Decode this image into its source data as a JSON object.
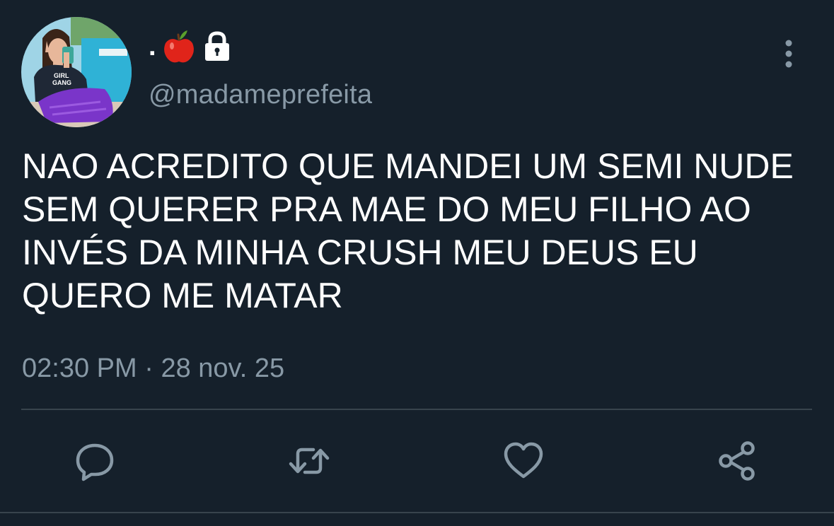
{
  "user": {
    "display_name": ".",
    "name_icons": [
      "apple-icon",
      "lock-icon"
    ],
    "handle": "@madameprefeita",
    "avatar_shirt_text": [
      "GIRL",
      "GANG"
    ]
  },
  "tweet": {
    "lines": [
      "NAO ACREDITO QUE MANDEI UM SEMI NUDE",
      "SEM QUERER PRA MAE DO MEU FILHO AO",
      "INVÉS DA MINHA CRUSH MEU DEUS EU",
      "QUERO ME MATAR"
    ],
    "time": "02:30 PM",
    "separator": " · ",
    "date": "28 nov. 25"
  },
  "actions": [
    "reply-icon",
    "retweet-icon",
    "like-icon",
    "share-icon"
  ],
  "colors": {
    "background": "#15202b",
    "text": "#ffffff",
    "secondary": "#8899a6",
    "divider": "#38444d"
  }
}
